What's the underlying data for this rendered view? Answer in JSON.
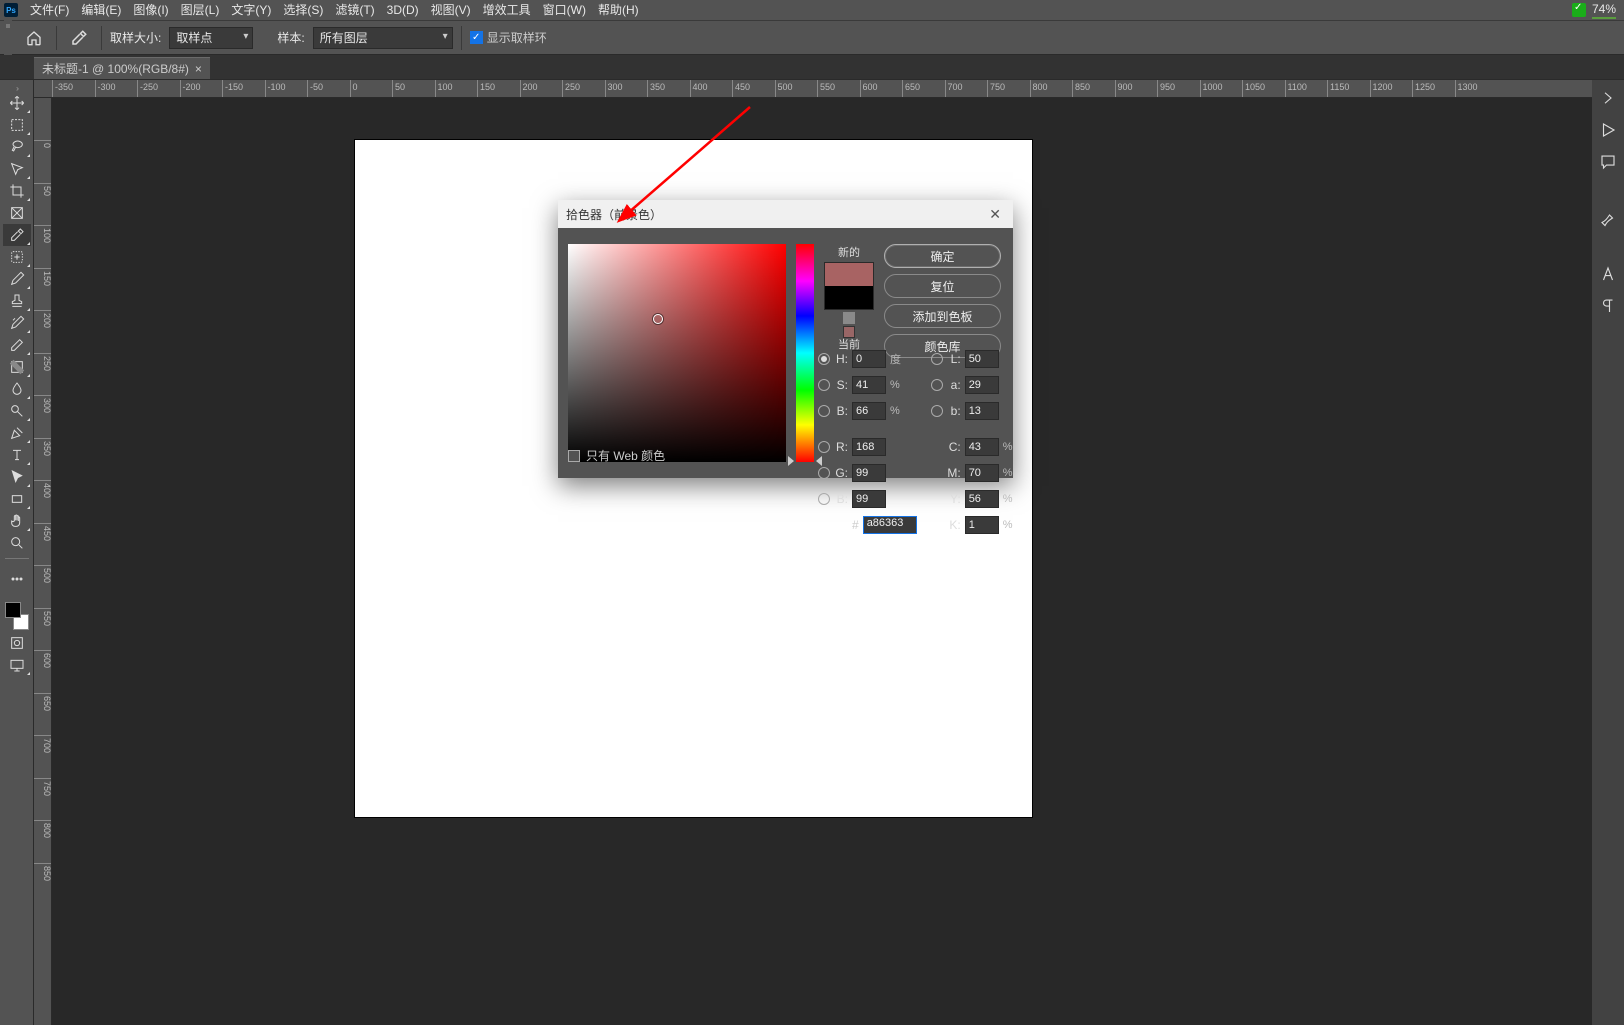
{
  "menu": {
    "items": [
      "文件(F)",
      "编辑(E)",
      "图像(I)",
      "图层(L)",
      "文字(Y)",
      "选择(S)",
      "滤镜(T)",
      "3D(D)",
      "视图(V)",
      "增效工具",
      "窗口(W)",
      "帮助(H)"
    ],
    "pct": "74%"
  },
  "options": {
    "sample_size_label": "取样大小:",
    "sample_size_value": "取样点",
    "sample_label": "样本:",
    "sample_value": "所有图层",
    "show_ring": "显示取样环"
  },
  "tab": {
    "title": "未标题-1 @ 100%(RGB/8#)"
  },
  "ruler_h": [
    "-350",
    "-300",
    "-250",
    "-200",
    "-150",
    "-100",
    "-50",
    "0",
    "50",
    "100",
    "150",
    "200",
    "250",
    "300",
    "350",
    "400",
    "450",
    "500",
    "550",
    "600",
    "650",
    "700",
    "750",
    "800",
    "850",
    "900",
    "950",
    "1000",
    "1050",
    "1100",
    "1150",
    "1200",
    "1250",
    "1300"
  ],
  "ruler_v": [
    "0",
    "50",
    "100",
    "150",
    "200",
    "250",
    "300",
    "350",
    "400",
    "450",
    "500",
    "550",
    "600",
    "650",
    "700",
    "750",
    "800",
    "850"
  ],
  "dialog": {
    "title": "拾色器（前景色）",
    "ok": "确定",
    "reset": "复位",
    "add": "添加到色板",
    "library": "颜色库",
    "new": "新的",
    "current": "当前",
    "webonly": "只有 Web 颜色",
    "H": {
      "lab": "H:",
      "val": "0",
      "unit": "度"
    },
    "S": {
      "lab": "S:",
      "val": "41",
      "unit": "%"
    },
    "Bv": {
      "lab": "B:",
      "val": "66",
      "unit": "%"
    },
    "R": {
      "lab": "R:",
      "val": "168"
    },
    "G": {
      "lab": "G:",
      "val": "99"
    },
    "B": {
      "lab": "B:",
      "val": "99"
    },
    "L": {
      "lab": "L:",
      "val": "50"
    },
    "a": {
      "lab": "a:",
      "val": "29"
    },
    "b": {
      "lab": "b:",
      "val": "13"
    },
    "C": {
      "lab": "C:",
      "val": "43",
      "unit": "%"
    },
    "M": {
      "lab": "M:",
      "val": "70",
      "unit": "%"
    },
    "Y": {
      "lab": "Y:",
      "val": "56",
      "unit": "%"
    },
    "K": {
      "lab": "K:",
      "val": "1",
      "unit": "%"
    },
    "hex_label": "#",
    "hex": "a86363"
  },
  "colors": {
    "new": "#a86363",
    "current": "#000000"
  }
}
